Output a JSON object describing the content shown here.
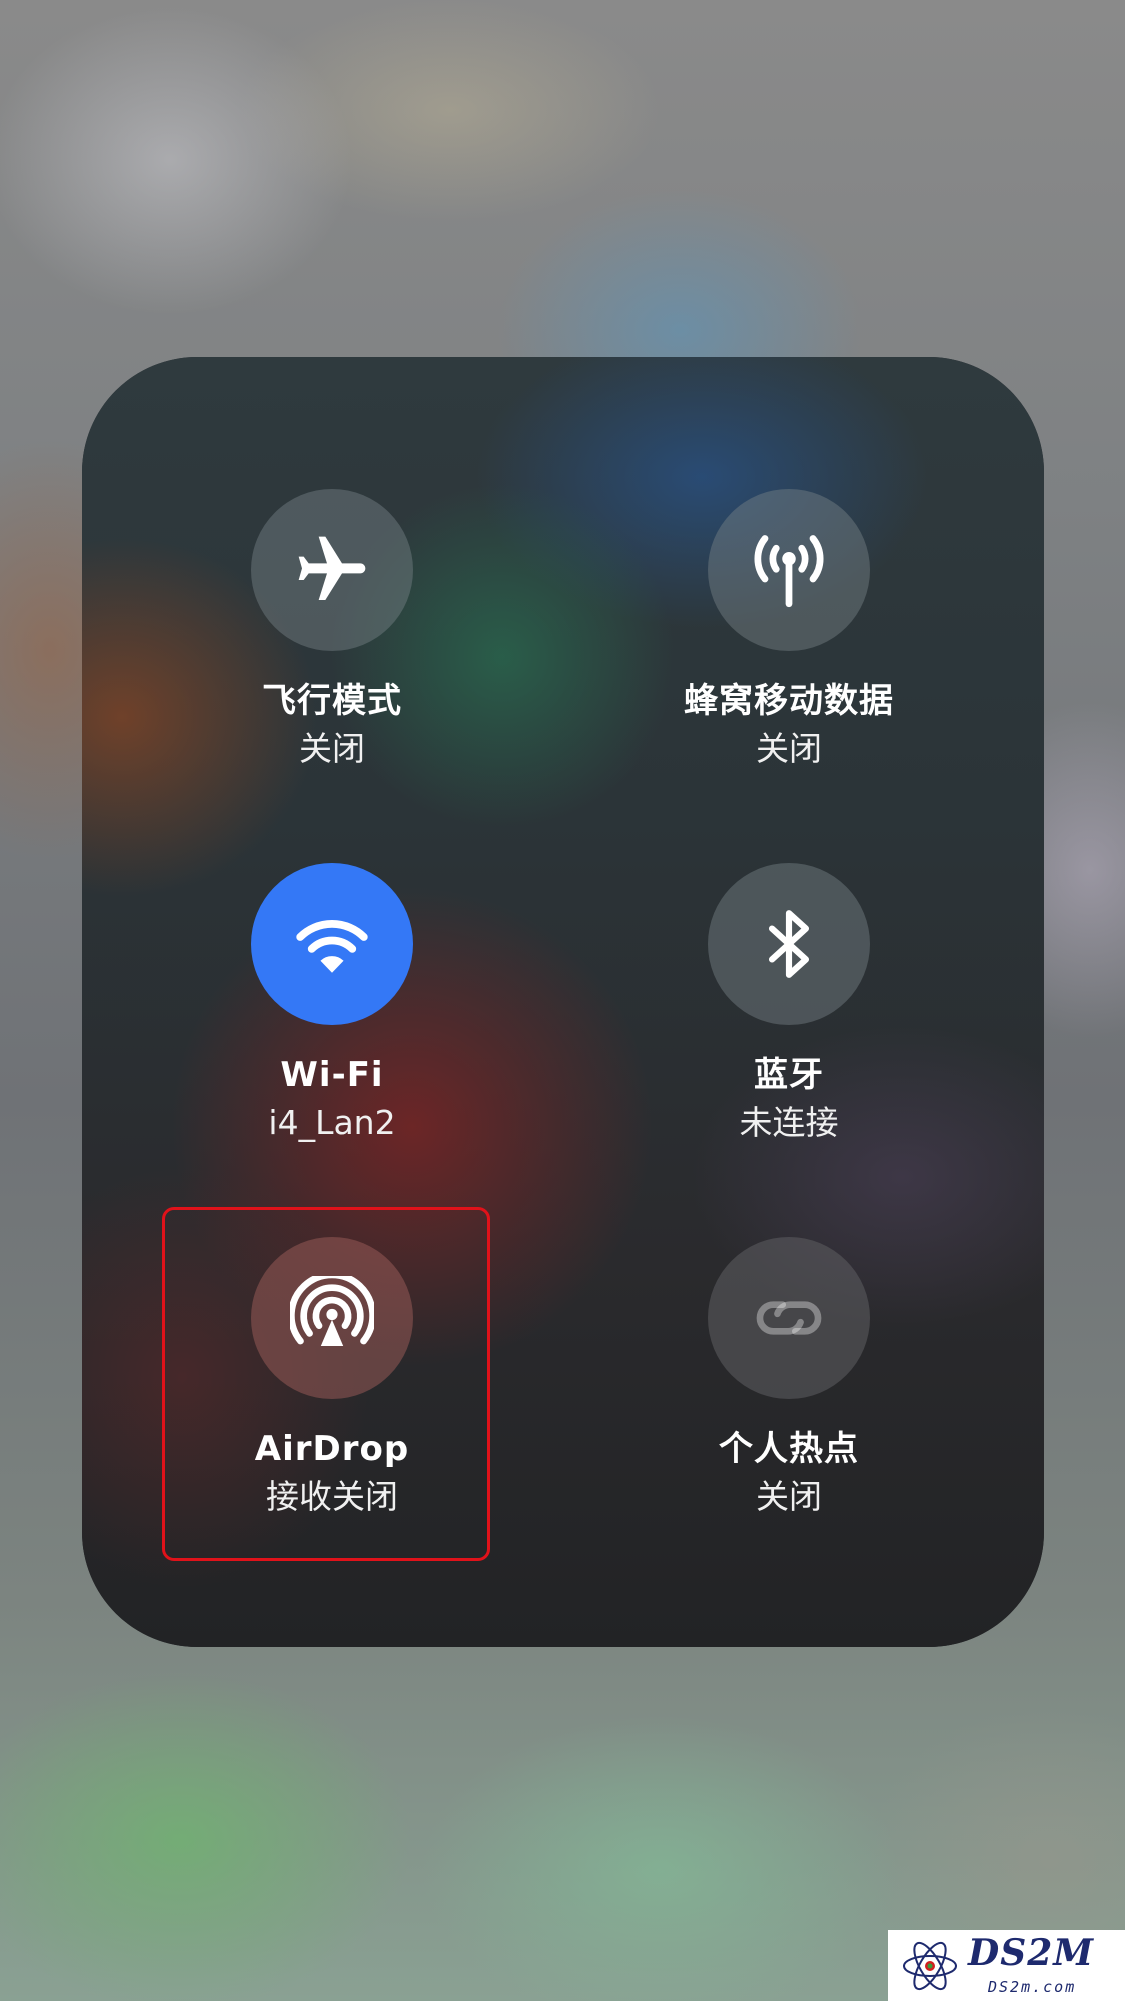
{
  "panel": {
    "tiles": [
      {
        "label": "飞行模式",
        "status": "关闭",
        "icon": "airplane-icon"
      },
      {
        "label": "蜂窝移动数据",
        "status": "关闭",
        "icon": "cellular-antenna-icon"
      },
      {
        "label": "Wi-Fi",
        "status": "i4_Lan2",
        "icon": "wifi-icon"
      },
      {
        "label": "蓝牙",
        "status": "未连接",
        "icon": "bluetooth-icon"
      },
      {
        "label": "AirDrop",
        "status": "接收关闭",
        "icon": "airdrop-icon"
      },
      {
        "label": "个人热点",
        "status": "关闭",
        "icon": "hotspot-link-icon"
      }
    ]
  },
  "colors": {
    "wifi_active": "#3478f6",
    "highlight_box": "#e0121a"
  },
  "watermark": {
    "brand": "DS2M",
    "domain": "DS2m.com"
  }
}
